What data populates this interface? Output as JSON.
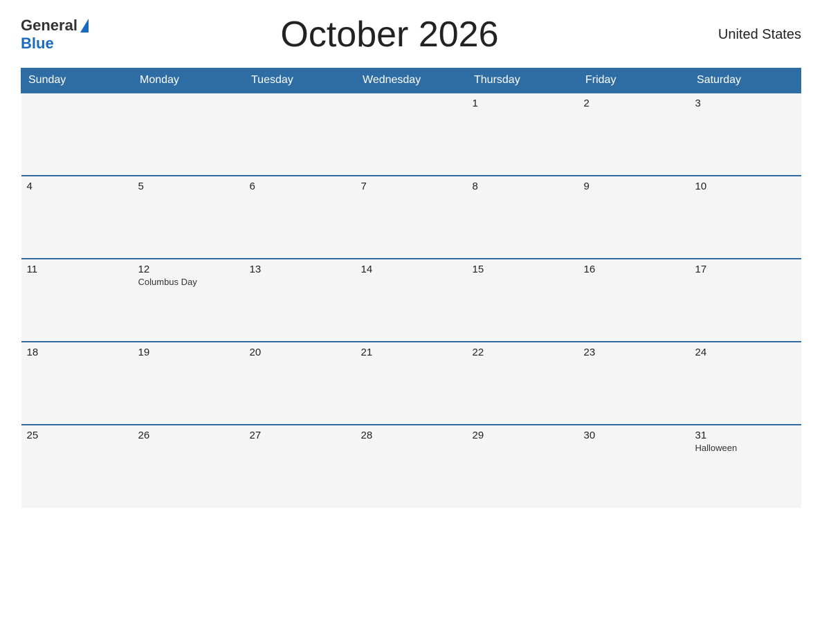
{
  "header": {
    "logo_general": "General",
    "logo_blue": "Blue",
    "title": "October 2026",
    "country": "United States"
  },
  "calendar": {
    "days_of_week": [
      "Sunday",
      "Monday",
      "Tuesday",
      "Wednesday",
      "Thursday",
      "Friday",
      "Saturday"
    ],
    "weeks": [
      [
        {
          "day": "",
          "holiday": ""
        },
        {
          "day": "",
          "holiday": ""
        },
        {
          "day": "",
          "holiday": ""
        },
        {
          "day": "",
          "holiday": ""
        },
        {
          "day": "1",
          "holiday": ""
        },
        {
          "day": "2",
          "holiday": ""
        },
        {
          "day": "3",
          "holiday": ""
        }
      ],
      [
        {
          "day": "4",
          "holiday": ""
        },
        {
          "day": "5",
          "holiday": ""
        },
        {
          "day": "6",
          "holiday": ""
        },
        {
          "day": "7",
          "holiday": ""
        },
        {
          "day": "8",
          "holiday": ""
        },
        {
          "day": "9",
          "holiday": ""
        },
        {
          "day": "10",
          "holiday": ""
        }
      ],
      [
        {
          "day": "11",
          "holiday": ""
        },
        {
          "day": "12",
          "holiday": "Columbus Day"
        },
        {
          "day": "13",
          "holiday": ""
        },
        {
          "day": "14",
          "holiday": ""
        },
        {
          "day": "15",
          "holiday": ""
        },
        {
          "day": "16",
          "holiday": ""
        },
        {
          "day": "17",
          "holiday": ""
        }
      ],
      [
        {
          "day": "18",
          "holiday": ""
        },
        {
          "day": "19",
          "holiday": ""
        },
        {
          "day": "20",
          "holiday": ""
        },
        {
          "day": "21",
          "holiday": ""
        },
        {
          "day": "22",
          "holiday": ""
        },
        {
          "day": "23",
          "holiday": ""
        },
        {
          "day": "24",
          "holiday": ""
        }
      ],
      [
        {
          "day": "25",
          "holiday": ""
        },
        {
          "day": "26",
          "holiday": ""
        },
        {
          "day": "27",
          "holiday": ""
        },
        {
          "day": "28",
          "holiday": ""
        },
        {
          "day": "29",
          "holiday": ""
        },
        {
          "day": "30",
          "holiday": ""
        },
        {
          "day": "31",
          "holiday": "Halloween"
        }
      ]
    ]
  }
}
